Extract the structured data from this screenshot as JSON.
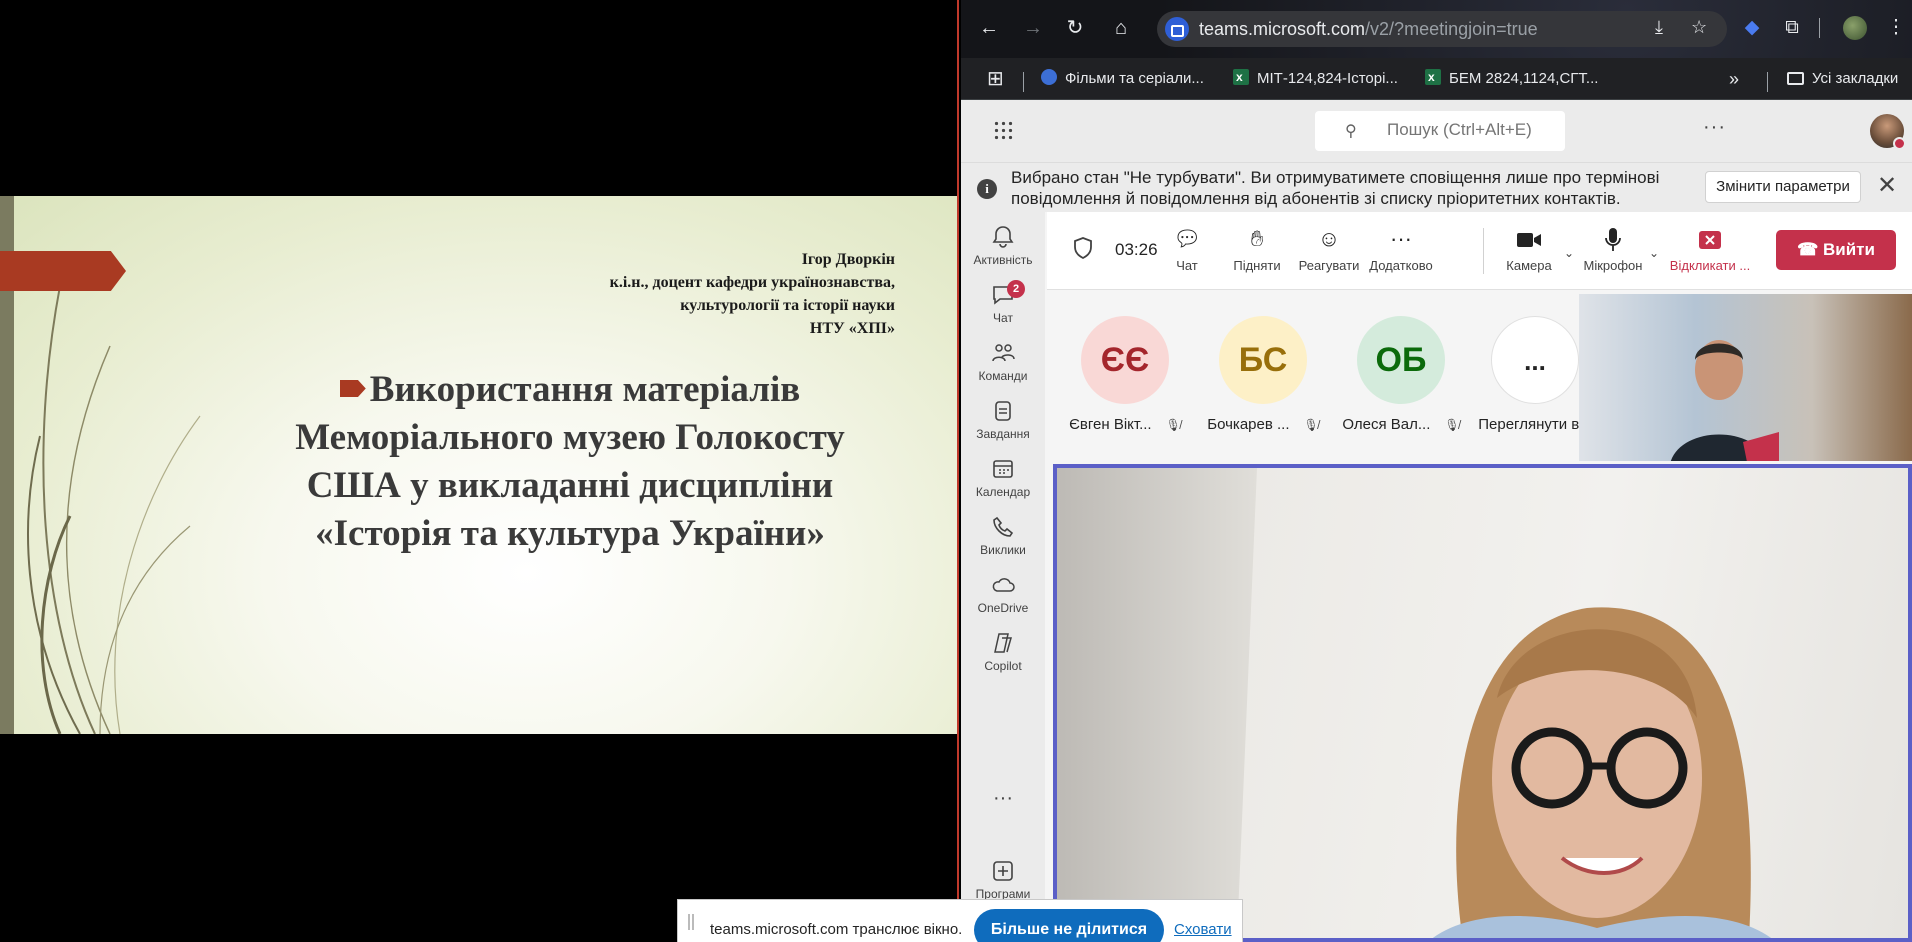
{
  "slide": {
    "author_name": "Ігор Дворкін",
    "author_line2": "к.і.н., доцент кафедри українознавства,",
    "author_line3": "культурології та історії науки",
    "author_line4": "НТУ «ХПІ»",
    "title_line1": "Використання матеріалів",
    "title_line2": "Меморіального музею Голокосту",
    "title_line3": "США у викладанні дисципліни",
    "title_line4": "«Історія та культура України»"
  },
  "browser": {
    "url_domain": "teams.microsoft.com",
    "url_path": "/v2/?meetingjoin=true",
    "icons": [
      "back-icon",
      "forward-icon",
      "reload-icon",
      "home-icon",
      "install-icon",
      "star-icon",
      "extension-icon",
      "puzzle-icon",
      "menu-icon"
    ],
    "bookmarks": [
      {
        "label": "Фільми та серіали..."
      },
      {
        "label": "МІТ-124,824-Історі..."
      },
      {
        "label": "БЕМ 2824,1124,СГТ..."
      }
    ],
    "all_bookmarks": "Усі закладки",
    "overflow": "»"
  },
  "teams": {
    "search_placeholder": "Пошук (Ctrl+Alt+E)",
    "banner_text": "Вибрано стан \"Не турбувати\". Ви отримуватимете сповіщення лише про термінові повідомлення й повідомлення від абонентів зі списку пріоритетних контактів.",
    "banner_button": "Змінити параметри",
    "rail": [
      {
        "label": "Активність"
      },
      {
        "label": "Чат",
        "badge": "2"
      },
      {
        "label": "Команди"
      },
      {
        "label": "Завдання"
      },
      {
        "label": "Календар"
      },
      {
        "label": "Виклики"
      },
      {
        "label": "OneDrive"
      },
      {
        "label": "Copilot"
      },
      {
        "label": "..."
      },
      {
        "label": "Програми"
      }
    ],
    "meeting": {
      "timer": "03:26",
      "controls": {
        "chat": "Чат",
        "raise": "Підняти",
        "react": "Реагувати",
        "more": "Додатково",
        "camera": "Камера",
        "mic": "Мікрофон",
        "stop_share": "Відкликати ...",
        "leave": "Вийти"
      },
      "participants": [
        {
          "initials": "ЄЄ",
          "name": "Євген Вікт...",
          "bg": "#f9d8d6",
          "fg": "#a4262c"
        },
        {
          "initials": "БС",
          "name": "Бочкарев ...",
          "bg": "#fdf0c7",
          "fg": "#986f0b"
        },
        {
          "initials": "ОБ",
          "name": "Олеся Вал...",
          "bg": "#d4ebdc",
          "fg": "#0b6a0b"
        },
        {
          "initials": "...",
          "name": "Переглянути в..."
        }
      ]
    }
  },
  "share_bar": {
    "text": "teams.microsoft.com транслює вікно.",
    "stop_button": "Більше не ділитися",
    "hide_link": "Сховати"
  },
  "colors": {
    "teams_accent": "#5b5fc7",
    "leave_red": "#c4314b",
    "slide_accent": "#a93a22",
    "share_blue": "#0f6cbd"
  }
}
